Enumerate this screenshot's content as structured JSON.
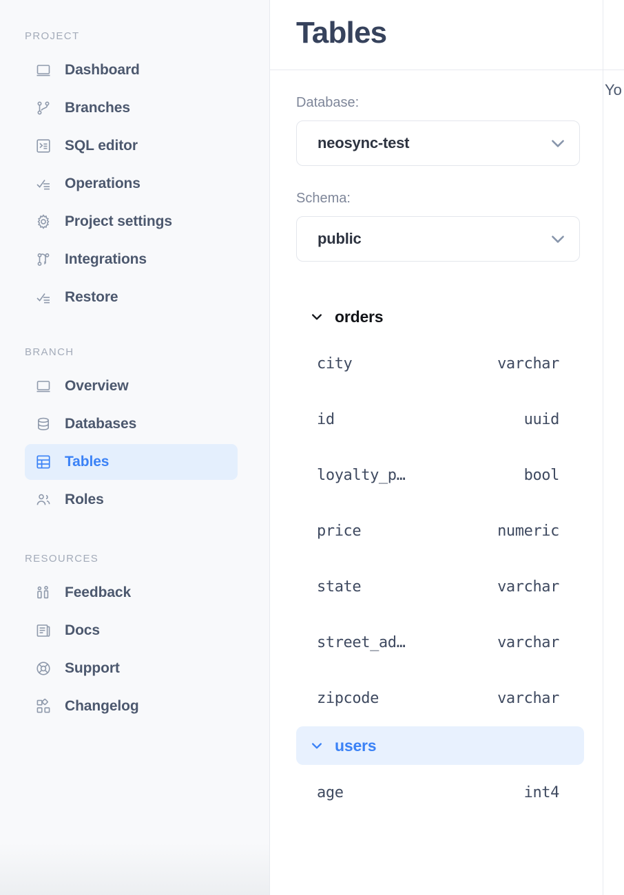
{
  "sidebar": {
    "sections": [
      {
        "heading": "PROJECT",
        "items": [
          {
            "label": "Dashboard",
            "icon": "dashboard-icon",
            "active": false
          },
          {
            "label": "Branches",
            "icon": "branches-icon",
            "active": false
          },
          {
            "label": "SQL editor",
            "icon": "sql-editor-icon",
            "active": false
          },
          {
            "label": "Operations",
            "icon": "operations-icon",
            "active": false
          },
          {
            "label": "Project settings",
            "icon": "gear-icon",
            "active": false
          },
          {
            "label": "Integrations",
            "icon": "integrations-icon",
            "active": false
          },
          {
            "label": "Restore",
            "icon": "restore-icon",
            "active": false
          }
        ]
      },
      {
        "heading": "BRANCH",
        "items": [
          {
            "label": "Overview",
            "icon": "overview-icon",
            "active": false
          },
          {
            "label": "Databases",
            "icon": "database-icon",
            "active": false
          },
          {
            "label": "Tables",
            "icon": "table-icon",
            "active": true
          },
          {
            "label": "Roles",
            "icon": "users-icon",
            "active": false
          }
        ]
      },
      {
        "heading": "RESOURCES",
        "items": [
          {
            "label": "Feedback",
            "icon": "feedback-icon",
            "active": false
          },
          {
            "label": "Docs",
            "icon": "docs-icon",
            "active": false
          },
          {
            "label": "Support",
            "icon": "lifebuoy-icon",
            "active": false
          },
          {
            "label": "Changelog",
            "icon": "changelog-icon",
            "active": false
          }
        ]
      }
    ]
  },
  "header": {
    "title": "Tables"
  },
  "filters": {
    "database": {
      "label": "Database:",
      "value": "neosync-test",
      "caret": "chevron-down-icon"
    },
    "schema": {
      "label": "Schema:",
      "value": "public",
      "caret": "chevron-down-icon"
    }
  },
  "tree": {
    "groups": [
      {
        "name": "orders",
        "expanded": true,
        "selected": false,
        "caret": "chevron-down-icon",
        "columns": [
          {
            "name": "city",
            "type": "varchar"
          },
          {
            "name": "id",
            "type": "uuid"
          },
          {
            "name": "loyalty_p…",
            "type": "bool"
          },
          {
            "name": "price",
            "type": "numeric"
          },
          {
            "name": "state",
            "type": "varchar"
          },
          {
            "name": "street_ad…",
            "type": "varchar"
          },
          {
            "name": "zipcode",
            "type": "varchar"
          }
        ]
      },
      {
        "name": "users",
        "expanded": true,
        "selected": true,
        "caret": "chevron-down-icon",
        "columns": [
          {
            "name": "age",
            "type": "int4"
          }
        ]
      }
    ]
  },
  "right_panel": {
    "text": "Yo"
  },
  "colors": {
    "accent": "#3b82f6",
    "accent_bg": "#e4effd",
    "sidebar_bg": "#f8f9fb",
    "border": "#e7eaef",
    "text": "#4c586e",
    "muted": "#a3abb9",
    "mono_text": "#3f4a60",
    "scrollbar_thumb": "#c2c2c2"
  }
}
